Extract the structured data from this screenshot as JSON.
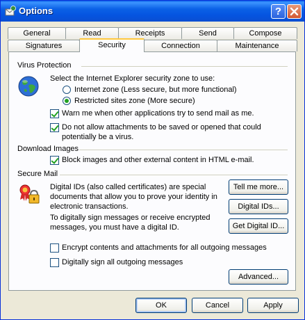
{
  "window": {
    "title": "Options",
    "help_label": "?",
    "close_label": "✕"
  },
  "tabs_top": [
    "General",
    "Read",
    "Receipts",
    "Send",
    "Compose"
  ],
  "tabs_bottom": [
    "Signatures",
    "Security",
    "Connection",
    "Maintenance"
  ],
  "active_tab": "Security",
  "virus": {
    "heading": "Virus Protection",
    "zone_prompt": "Select the Internet Explorer security zone to use:",
    "internet_zone": "Internet zone (Less secure, but more functional)",
    "restricted_zone": "Restricted sites zone (More secure)",
    "selected_zone": "restricted",
    "warn_label": "Warn me when other applications try to send mail as me.",
    "warn_checked": true,
    "attach_label_1": "Do not allow attachments to be saved or opened that could",
    "attach_label_2": "potentially be a virus.",
    "attach_checked": true
  },
  "images": {
    "heading": "Download Images",
    "block_label": "Block images and other external content in HTML e-mail.",
    "block_checked": true
  },
  "secure": {
    "heading": "Secure Mail",
    "desc_1": "Digital IDs (also called certificates) are special",
    "desc_2": "documents that allow you to prove your identity in",
    "desc_3": "electronic transactions.",
    "desc_4": "To digitally sign messages or receive encrypted",
    "desc_5": "messages, you must have a digital ID.",
    "tell_me_more": "Tell me more...",
    "digital_ids": "Digital IDs...",
    "get_digital_id": "Get Digital ID...",
    "encrypt_label": "Encrypt contents and attachments for all outgoing messages",
    "encrypt_checked": false,
    "sign_label": "Digitally sign all outgoing messages",
    "sign_checked": false,
    "advanced": "Advanced..."
  },
  "buttons": {
    "ok": "OK",
    "cancel": "Cancel",
    "apply": "Apply"
  }
}
